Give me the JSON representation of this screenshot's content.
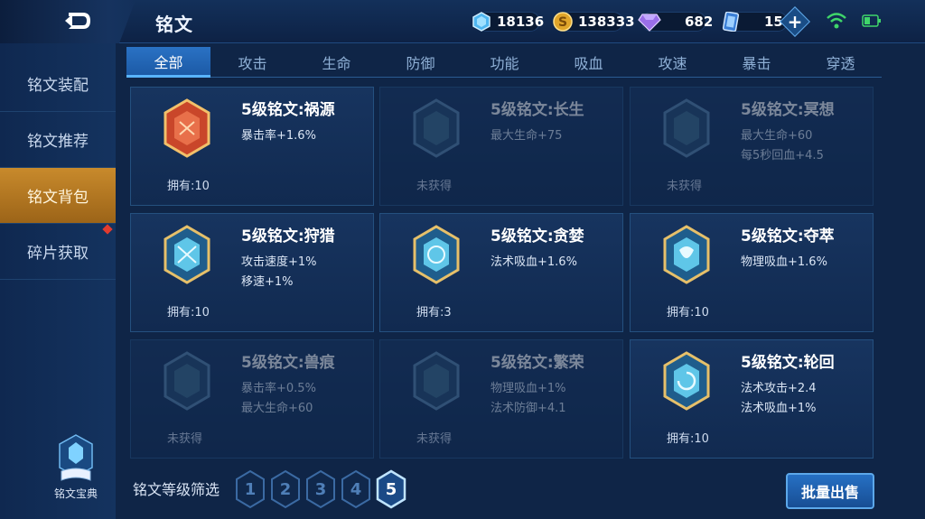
{
  "header": {
    "title": "铭文",
    "resources": [
      {
        "name": "diamond",
        "icon": "blue-crystal-icon",
        "value": "18136"
      },
      {
        "name": "gold",
        "icon": "gold-coin-icon",
        "value": "138333"
      },
      {
        "name": "gem",
        "icon": "purple-gem-icon",
        "value": "682"
      },
      {
        "name": "card",
        "icon": "ticket-card-icon",
        "value": "15"
      }
    ],
    "plus": "+"
  },
  "sidebar": {
    "items": [
      {
        "label": "铭文装配"
      },
      {
        "label": "铭文推荐"
      },
      {
        "label": "铭文背包"
      },
      {
        "label": "碎片获取"
      }
    ],
    "active_index": 2,
    "codex_label": "铭文宝典"
  },
  "tabs": [
    "全部",
    "攻击",
    "生命",
    "防御",
    "功能",
    "吸血",
    "攻速",
    "暴击",
    "穿透"
  ],
  "active_tab": 0,
  "cards": [
    {
      "name": "5级铭文:祸源",
      "stat1": "暴击率+1.6%",
      "stat2": "",
      "owned": "拥有:10",
      "dim": false,
      "color": "#c9462a"
    },
    {
      "name": "5级铭文:长生",
      "stat1": "最大生命+75",
      "stat2": "",
      "owned": "未获得",
      "dim": true,
      "color": "#3d6a8a"
    },
    {
      "name": "5级铭文:冥想",
      "stat1": "最大生命+60",
      "stat2": "每5秒回血+4.5",
      "owned": "未获得",
      "dim": true,
      "color": "#3d6a8a"
    },
    {
      "name": "5级铭文:狩猎",
      "stat1": "攻击速度+1%",
      "stat2": "移速+1%",
      "owned": "拥有:10",
      "dim": false,
      "color": "#5fc6e8"
    },
    {
      "name": "5级铭文:贪婪",
      "stat1": "法术吸血+1.6%",
      "stat2": "",
      "owned": "拥有:3",
      "dim": false,
      "color": "#5fc6e8"
    },
    {
      "name": "5级铭文:夺萃",
      "stat1": "物理吸血+1.6%",
      "stat2": "",
      "owned": "拥有:10",
      "dim": false,
      "color": "#5fc6e8"
    },
    {
      "name": "5级铭文:兽痕",
      "stat1": "暴击率+0.5%",
      "stat2": "最大生命+60",
      "owned": "未获得",
      "dim": true,
      "color": "#3d6a8a"
    },
    {
      "name": "5级铭文:繁荣",
      "stat1": "物理吸血+1%",
      "stat2": "法术防御+4.1",
      "owned": "未获得",
      "dim": true,
      "color": "#3d6a8a"
    },
    {
      "name": "5级铭文:轮回",
      "stat1": "法术攻击+2.4",
      "stat2": "法术吸血+1%",
      "owned": "拥有:10",
      "dim": false,
      "color": "#5fc6e8"
    }
  ],
  "filter": {
    "label": "铭文等级筛选",
    "levels": [
      "1",
      "2",
      "3",
      "4",
      "5"
    ],
    "active_level": 4
  },
  "sell_button": "批量出售",
  "colors": {
    "accent_blue": "#2a72c4",
    "active_gold": "#c88a2c",
    "background": "#0f2547"
  }
}
